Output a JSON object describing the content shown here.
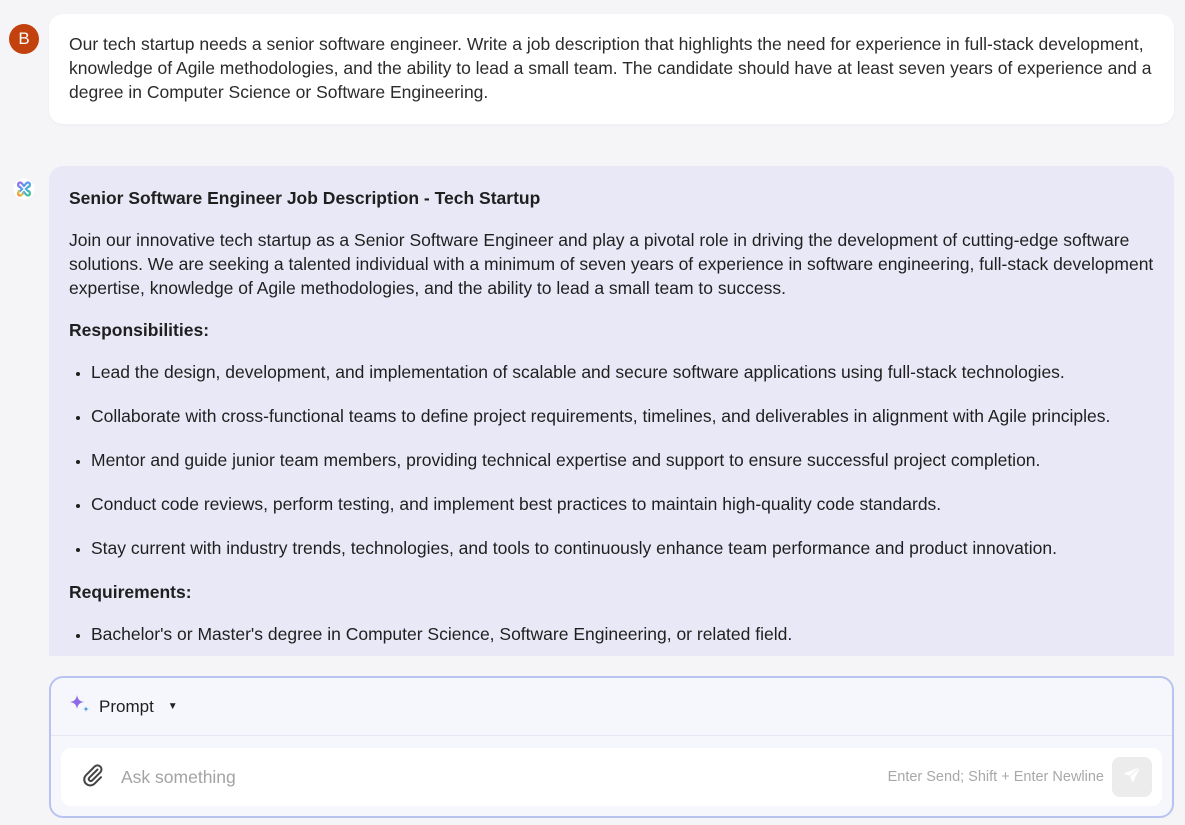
{
  "user_message": {
    "avatar_initial": "B",
    "text": "Our tech startup needs a senior software engineer. Write a job description that highlights the need for experience in full-stack development, knowledge of Agile methodologies, and the ability to lead a small team. The candidate should have at least seven years of experience and a degree in Computer Science or Software Engineering."
  },
  "ai_message": {
    "icon": "ai-assistant-logo-icon",
    "title": "Senior Software Engineer Job Description - Tech Startup",
    "intro": "Join our innovative tech startup as a Senior Software Engineer and play a pivotal role in driving the development of cutting-edge software solutions. We are seeking a talented individual with a minimum of seven years of experience in software engineering, full-stack development expertise, knowledge of Agile methodologies, and the ability to lead a small team to success.",
    "sections": [
      {
        "heading": "Responsibilities:",
        "items": [
          "Lead the design, development, and implementation of scalable and secure software applications using full-stack technologies.",
          "Collaborate with cross-functional teams to define project requirements, timelines, and deliverables in alignment with Agile principles.",
          "Mentor and guide junior team members, providing technical expertise and support to ensure successful project completion.",
          "Conduct code reviews, perform testing, and implement best practices to maintain high-quality code standards.",
          "Stay current with industry trends, technologies, and tools to continuously enhance team performance and product innovation."
        ]
      },
      {
        "heading": "Requirements:",
        "items": [
          "Bachelor's or Master's degree in Computer Science, Software Engineering, or related field."
        ]
      }
    ]
  },
  "composer": {
    "prompt_label": "Prompt",
    "input_placeholder": "Ask something",
    "input_value": "",
    "hint": "Enter Send; Shift + Enter Newline"
  },
  "colors": {
    "avatar_bg": "#c2410c",
    "ai_bubble_bg": "#e9e8f7",
    "composer_border": "#b9c3ef",
    "page_bg": "#f5f5f8"
  }
}
